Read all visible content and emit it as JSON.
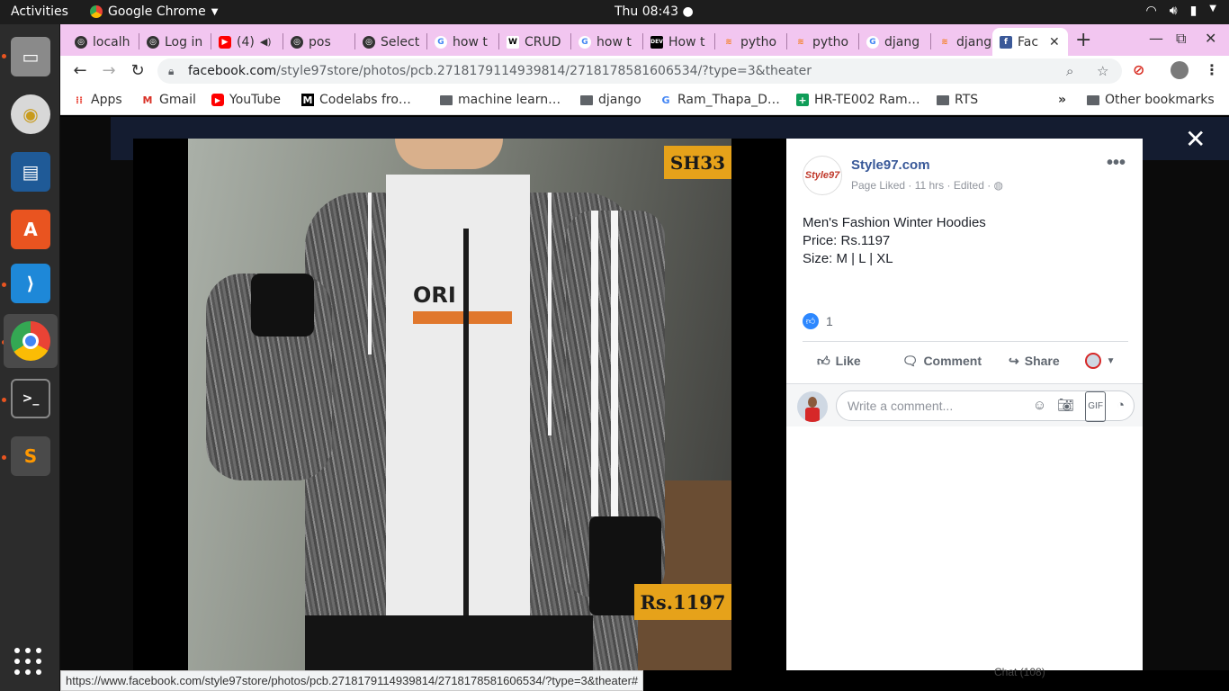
{
  "topbar": {
    "activities": "Activities",
    "app_name": "Google Chrome",
    "clock": "Thu 08:43"
  },
  "dock": {
    "items": [
      "file-manager",
      "rhythmbox",
      "libreoffice-impress",
      "ubuntu-software",
      "vscode",
      "google-chrome",
      "terminal",
      "sublime-text"
    ]
  },
  "tabs": [
    {
      "label": "localh",
      "icon": "globe-icon"
    },
    {
      "label": "Log in",
      "icon": "globe-icon"
    },
    {
      "label": "(4)",
      "icon": "youtube-icon"
    },
    {
      "label": "pos",
      "icon": "globe-icon"
    },
    {
      "label": "Select",
      "icon": "globe-icon"
    },
    {
      "label": "how t",
      "icon": "google-icon"
    },
    {
      "label": "CRUD",
      "icon": "w3-icon"
    },
    {
      "label": "how t",
      "icon": "google-icon"
    },
    {
      "label": "How t",
      "icon": "dev-icon"
    },
    {
      "label": "pytho",
      "icon": "stackoverflow-icon"
    },
    {
      "label": "pytho",
      "icon": "stackoverflow-icon"
    },
    {
      "label": "djang",
      "icon": "google-icon"
    },
    {
      "label": "djang",
      "icon": "stackoverflow-icon"
    },
    {
      "label": "Fac",
      "icon": "facebook-icon"
    }
  ],
  "omnibox": {
    "host": "facebook.com",
    "path": "/style97store/photos/pcb.2718179114939814/2718178581606534/?type=3&theater"
  },
  "bookmarks": {
    "apps": "Apps",
    "gmail": "Gmail",
    "youtube": "YouTube",
    "codelabs": "Codelabs fro…",
    "machine": "machine learn…",
    "django": "django",
    "ram": "Ram_Thapa_D…",
    "hr": "HR-TE002 Ram…",
    "rts": "RTS",
    "more": "»",
    "other": "Other bookmarks"
  },
  "photo": {
    "code_tag": "SH33",
    "price_tag": "Rs.1197"
  },
  "post": {
    "page_name": "Style97.com",
    "avatar_text": "Style97",
    "meta": "Page Liked · 11 hrs · Edited ·",
    "line1": "Men's Fashion Winter Hoodies",
    "line2": "Price: Rs.1197",
    "line3": "Size: M | L | XL",
    "reaction_count": "1",
    "like": "Like",
    "comment": "Comment",
    "share": "Share",
    "comment_placeholder": "Write a comment..."
  },
  "status_url": "https://www.facebook.com/style97store/photos/pcb.2718179114939814/2718178581606534/?type=3&theater#",
  "bg_chat": "Chat (108)"
}
